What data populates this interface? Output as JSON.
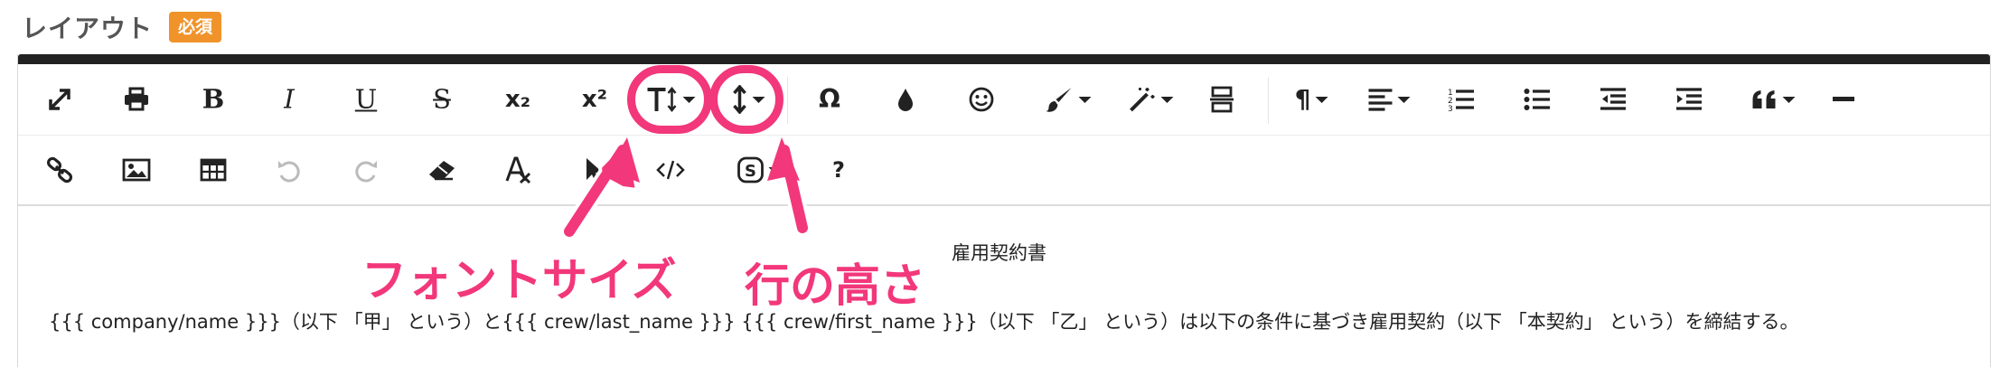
{
  "field": {
    "label": "レイアウト",
    "required_badge": "必須"
  },
  "toolbar": {
    "superscript_label": "x²",
    "subscript_label": "x₂",
    "omega_label": "Ω",
    "pilcrow_label": "¶",
    "help_label": "?",
    "bold_label": "B",
    "italic_label": "I",
    "underline_label": "U",
    "strike_label": "S"
  },
  "annotations": {
    "font_size": "フォントサイズ",
    "line_height": "行の高さ",
    "highlight_color": "#f2377a"
  },
  "content": {
    "title": "雇用契約書",
    "body": "{{{ company/name }}}（以下 「甲」 という）と{{{ crew/last_name }}} {{{ crew/first_name }}}（以下 「乙」 という）は以下の条件に基づき雇用契約（以下 「本契約」 という）を締結する。"
  }
}
